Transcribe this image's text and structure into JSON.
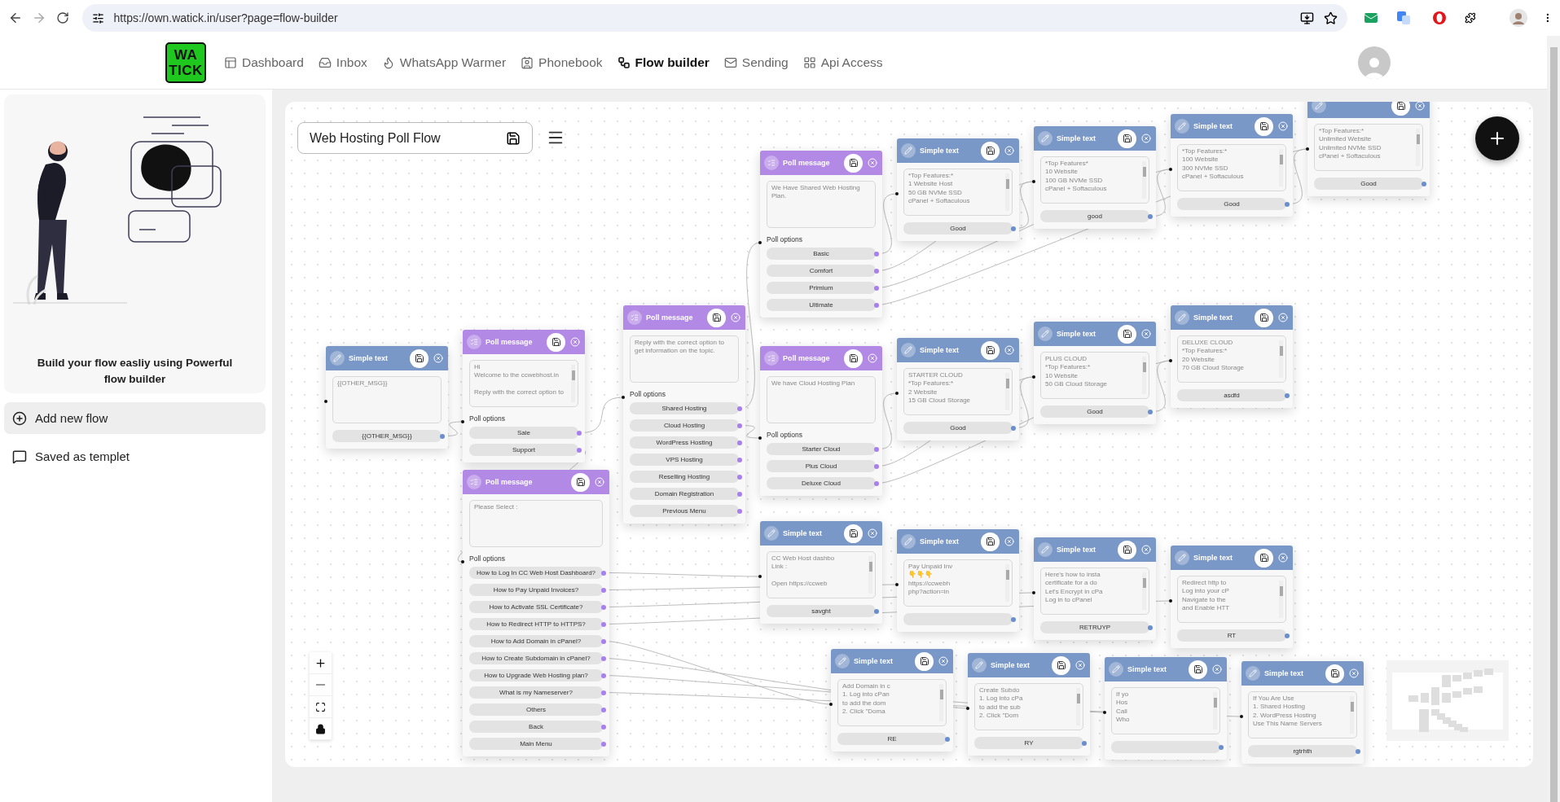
{
  "browser": {
    "url": "https://own.watick.in/user?page=flow-builder"
  },
  "nav": {
    "logo": [
      "WA",
      "TICK"
    ],
    "items": [
      {
        "label": "Dashboard",
        "selected": false
      },
      {
        "label": "Inbox",
        "selected": false
      },
      {
        "label": "WhatsApp Warmer",
        "selected": false
      },
      {
        "label": "Phonebook",
        "selected": false
      },
      {
        "label": "Flow builder",
        "selected": true
      },
      {
        "label": "Sending",
        "selected": false
      },
      {
        "label": "Api Access",
        "selected": false
      }
    ]
  },
  "sidebar": {
    "caption": "Build your flow easliy using Powerful flow builder",
    "items": [
      {
        "label": "Add new flow",
        "selected": true
      },
      {
        "label": "Saved as templet",
        "selected": false
      }
    ]
  },
  "flow": {
    "name": "Web Hosting Poll Flow",
    "nodes": [
      {
        "kind": "text",
        "title": "Simple text",
        "message": "{{OTHER_MSG}}",
        "button": "{{OTHER_MSG}}"
      },
      {
        "kind": "poll",
        "title": "Poll message",
        "message": "Hi\nWelcome to the ccwebhost.in\n\nReply with the correct option to",
        "options_label": "Poll options",
        "options": [
          "Sale",
          "Support"
        ]
      },
      {
        "kind": "poll",
        "title": "Poll message",
        "message": "Reply with the correct option to get information on the topic.",
        "options_label": "Poll options",
        "options": [
          "Shared Hosting",
          "Cloud Hosting",
          "WordPress Hosting",
          "VPS Hosting",
          "Reselling Hosting",
          "Domain Registration",
          "Previous Menu"
        ]
      },
      {
        "kind": "poll",
        "title": "Poll message",
        "message": "We Have Shared Web Hosting Plan.",
        "options_label": "Poll options",
        "options": [
          "Basic",
          "Comfort",
          "Primium",
          "Ultimate"
        ]
      },
      {
        "kind": "poll",
        "title": "Poll message",
        "message": "We have Cloud Hosting Plan",
        "options_label": "Poll options",
        "options": [
          "Starter Cloud",
          "Plus Cloud",
          "Deluxe Cloud"
        ]
      },
      {
        "kind": "poll",
        "title": "Poll message",
        "message": "Please Select :",
        "options_label": "Poll options",
        "options": [
          "How to Log In CC Web Host Dashboard?",
          "How to Pay Unpaid Invoices?",
          "How to Activate SSL Certificate?",
          "How to Redirect HTTP to HTTPS?",
          "How to Add Domain in cPanel?",
          "How to Create Subdomain in cPanel?",
          "How to Upgrade Web Hosting plan?",
          "What is my Nameserver?",
          "Others",
          "Back",
          "Main Menu"
        ]
      },
      {
        "kind": "text",
        "title": "Simple text",
        "message": "*Top Features:*\n1 Website Host\n50 GB NVMe SSD\ncPanel + Softaculous",
        "button": "Good"
      },
      {
        "kind": "text",
        "title": "Simple text",
        "message": "*Top Features*\n10 Website\n100 GB NVMe SSD\ncPanel + Softaculous",
        "button": "good"
      },
      {
        "kind": "text",
        "title": "Simple text",
        "message": "*Top Features:*\n100 Website\n300 NVMe SSD\ncPanel + Softaculous",
        "button": "Good"
      },
      {
        "kind": "text",
        "message": "*Top Features:*\nUnlimited Website\nUnlimited NVMe SSD\ncPanel + Softaculous",
        "button": "Good"
      },
      {
        "kind": "text",
        "title": "Simple text",
        "message": "STARTER CLOUD\n*Top Features:*\n2 Website\n15 GB Cloud Storage",
        "button": "Good"
      },
      {
        "kind": "text",
        "title": "Simple text",
        "message": "PLUS CLOUD\n*Top Features:*\n10 Website\n50 GB Cloud Storage",
        "button": "Good"
      },
      {
        "kind": "text",
        "title": "Simple text",
        "message": "DELUXE CLOUD\n*Top Features:*\n20 Website\n70 GB Cloud Storage",
        "button": "asdfd"
      },
      {
        "kind": "text",
        "title": "Simple text",
        "message": "CC Web Host dashbo\nLink :\n\nOpen https://ccweb",
        "button": "savght"
      },
      {
        "kind": "text",
        "title": "Simple text",
        "message": "Pay Unpaid Inv\n👇👇👇\nhttps://ccwebh\nphp?action=in"
      },
      {
        "kind": "text",
        "title": "Simple text",
        "message": "Here's how to insta\ncertificate for a do\nLet's Encrypt in cPa\nLog in to cPanel",
        "button": "RETRUYP"
      },
      {
        "kind": "text",
        "title": "Simple text",
        "message": "Redirect http to\nLog into your cP\nNavigate to the\nand Enable HTT",
        "button": "RT"
      },
      {
        "kind": "text",
        "title": "Simple text",
        "message": "Add Domain in c\n1. Log into cPan\nto add the dom\n2. Click \"Doma",
        "button": "RE"
      },
      {
        "kind": "text",
        "title": "Simple text",
        "message": "Create Subdo\n1. Log into cPa\nto add the sub\n2. Click \"Dom",
        "button": "RY"
      },
      {
        "kind": "text",
        "title": "Simple text",
        "message": "If yo\nHos\nCall\nWho"
      },
      {
        "kind": "text",
        "title": "Simple text",
        "message": "If You Are Use\n1. Shared Hosting\n2. WordPress Hosting\nUse This Name Servers",
        "button": "rgtrhth"
      }
    ]
  }
}
